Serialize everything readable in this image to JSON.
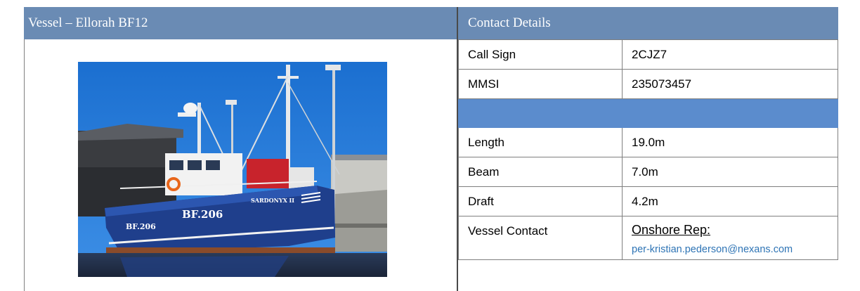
{
  "vessel": {
    "header": "Vessel – Ellorah BF12"
  },
  "contact": {
    "header": "Contact Details",
    "rows": [
      {
        "label": "Call Sign",
        "value": "2CJZ7"
      },
      {
        "label": "MMSI",
        "value": "235073457"
      },
      {
        "label": "Length",
        "value": "19.0m"
      },
      {
        "label": "Beam",
        "value": "7.0m"
      },
      {
        "label": "Draft",
        "value": "4.2m"
      }
    ],
    "vessel_contact": {
      "label": "Vessel Contact",
      "rep_label": "Onshore Rep:",
      "email": "per-kristian.pederson@nexans.com"
    }
  },
  "colors": {
    "header_bg": "#6a8bb4",
    "separator_bg": "#5b8ccd",
    "hull": "#1f3f8c",
    "link": "#2e74b5"
  }
}
